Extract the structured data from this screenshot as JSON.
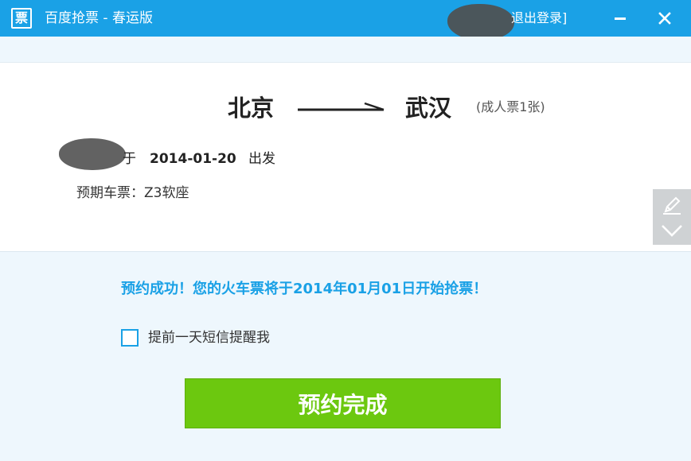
{
  "titlebar": {
    "icon_glyph": "票",
    "title": "百度抢票 - 春运版",
    "logout_label": "退出登录]",
    "bg_color": "#1aa1e6",
    "icons": {
      "minimize": "minimize-icon",
      "close": "close-icon"
    }
  },
  "route": {
    "from": "北京",
    "to": "武汉",
    "ticket_type": "(成人票1张)"
  },
  "trip": {
    "prefix": "于",
    "date": "2014-01-20",
    "suffix": "出发",
    "expect": "预期车票：Z3软座"
  },
  "message": {
    "success": "预约成功！您的火车票将于2014年01月01日开始抢票！",
    "accent_color": "#1aa1e6"
  },
  "sms": {
    "label": "提前一天短信提醒我",
    "checked": false
  },
  "finish_button": {
    "label": "预约完成",
    "color": "#6cc80f"
  },
  "side_tool": {
    "icons": [
      "pencil-icon",
      "chevron-down-icon"
    ]
  }
}
